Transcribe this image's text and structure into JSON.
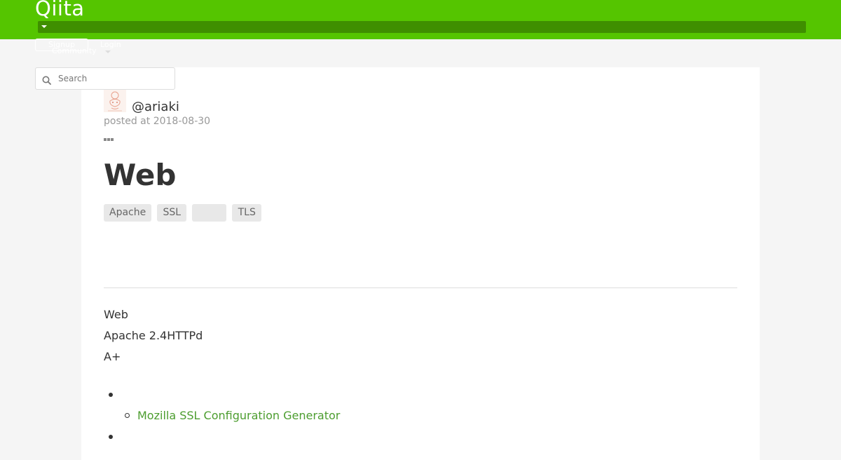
{
  "header": {
    "logo": "Qiita",
    "signup_label": "Signup",
    "login_label": "Login",
    "community_label": "Community"
  },
  "search": {
    "placeholder": "Search"
  },
  "article": {
    "author": "@ariaki",
    "posted": "posted at 2018-08-30",
    "title": "Web",
    "tags": [
      "Apache",
      "SSL",
      "",
      "TLS"
    ],
    "body": {
      "line1": "Web",
      "line2": "Apache 2.4HTTPd",
      "line3": "A+"
    },
    "link_label": "Mozilla SSL Configuration Generator"
  },
  "colors": {
    "brand": "#55c500",
    "nav_bar": "#3f8f00",
    "link": "#4c9d2f"
  },
  "icons": {
    "search": "search-icon",
    "more": "more-icon",
    "caret": "caret-down-icon"
  }
}
